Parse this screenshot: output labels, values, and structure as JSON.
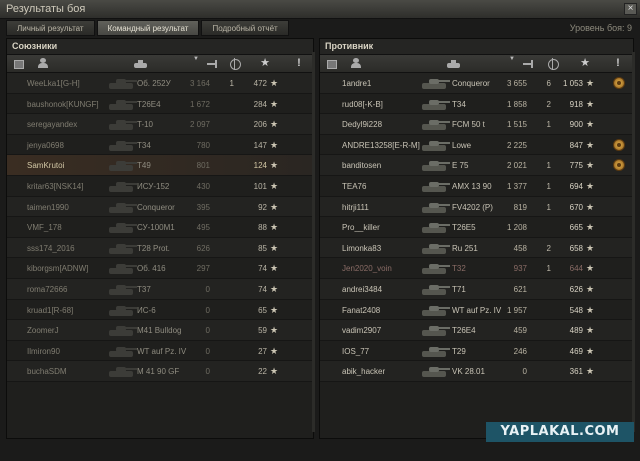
{
  "window": {
    "title": "Результаты боя",
    "close_label": "×"
  },
  "tabs": [
    {
      "label": "Личный результат",
      "active": false
    },
    {
      "label": "Командный результат",
      "active": true
    },
    {
      "label": "Подробный отчёт",
      "active": false
    }
  ],
  "battle_level": "Уровень боя: 9",
  "allies": {
    "title": "Союзники",
    "columns": [
      "square-icon",
      "person-icon",
      "tank-icon",
      "sort-arrow-icon",
      "damage-arrow-icon",
      "crosshair-icon",
      "star-icon",
      "exclamation-icon"
    ],
    "rows": [
      {
        "player": "WeeLka1[G-H]",
        "tank": "Об. 252У",
        "damage": "3 164",
        "kills": "1",
        "exp": "472"
      },
      {
        "player": "baushonok[KUNGF]",
        "tank": "T26E4",
        "damage": "1 672",
        "kills": "",
        "exp": "284"
      },
      {
        "player": "seregayandex",
        "tank": "T-10",
        "damage": "2 097",
        "kills": "",
        "exp": "206"
      },
      {
        "player": "jenya0698",
        "tank": "T34",
        "damage": "780",
        "kills": "",
        "exp": "147"
      },
      {
        "player": "SamKrutoi",
        "tank": "T49",
        "damage": "801",
        "kills": "",
        "exp": "124",
        "self": true
      },
      {
        "player": "kritar63[NSK14]",
        "tank": "ИСУ-152",
        "damage": "430",
        "kills": "",
        "exp": "101"
      },
      {
        "player": "taimen1990",
        "tank": "Conqueror",
        "damage": "395",
        "kills": "",
        "exp": "92"
      },
      {
        "player": "VMF_178",
        "tank": "СУ-100М1",
        "damage": "495",
        "kills": "",
        "exp": "88"
      },
      {
        "player": "sss174_2016",
        "tank": "T28 Prot.",
        "damage": "626",
        "kills": "",
        "exp": "85"
      },
      {
        "player": "kiborgsm[ADNW]",
        "tank": "Об. 416",
        "damage": "297",
        "kills": "",
        "exp": "74"
      },
      {
        "player": "roma72666",
        "tank": "T37",
        "damage": "0",
        "kills": "",
        "exp": "74"
      },
      {
        "player": "kruad1[R-68]",
        "tank": "ИС-6",
        "damage": "0",
        "kills": "",
        "exp": "65"
      },
      {
        "player": "ZoomerJ",
        "tank": "M41 Bulldog",
        "damage": "0",
        "kills": "",
        "exp": "59"
      },
      {
        "player": "Ilmiron90",
        "tank": "WT auf Pz. IV",
        "damage": "0",
        "kills": "",
        "exp": "27"
      },
      {
        "player": "buchaSDM",
        "tank": "M 41 90 GF",
        "damage": "0",
        "kills": "",
        "exp": "22"
      }
    ]
  },
  "enemies": {
    "title": "Противник",
    "columns": [
      "square-icon",
      "person-icon",
      "tank-icon",
      "sort-arrow-icon",
      "damage-arrow-icon",
      "crosshair-icon",
      "star-icon",
      "exclamation-icon"
    ],
    "rows": [
      {
        "player": "1andre1",
        "tank": "Conqueror",
        "damage": "3 655",
        "kills": "6",
        "exp": "1 053",
        "medal": true
      },
      {
        "player": "rud08[-K-B]",
        "tank": "T34",
        "damage": "1 858",
        "kills": "2",
        "exp": "918"
      },
      {
        "player": "Dedyl9i228",
        "tank": "FCM 50 t",
        "damage": "1 515",
        "kills": "1",
        "exp": "900"
      },
      {
        "player": "ANDRE13258[E-R-M]",
        "tank": "Lowe",
        "damage": "2 225",
        "kills": "",
        "exp": "847",
        "medal": true
      },
      {
        "player": "banditosen",
        "tank": "E 75",
        "damage": "2 021",
        "kills": "1",
        "exp": "775",
        "medal": true
      },
      {
        "player": "TEA76",
        "tank": "AMX 13 90",
        "damage": "1 377",
        "kills": "1",
        "exp": "694"
      },
      {
        "player": "hitrji111",
        "tank": "FV4202 (P)",
        "damage": "819",
        "kills": "1",
        "exp": "670"
      },
      {
        "player": "Pro__killer",
        "tank": "T26E5",
        "damage": "1 208",
        "kills": "",
        "exp": "665"
      },
      {
        "player": "Limonka83",
        "tank": "Ru 251",
        "damage": "458",
        "kills": "2",
        "exp": "658"
      },
      {
        "player": "Jen2020_voin",
        "tank": "T32",
        "damage": "937",
        "kills": "1",
        "exp": "644",
        "dead": true
      },
      {
        "player": "andrei3484",
        "tank": "T71",
        "damage": "621",
        "kills": "",
        "exp": "626"
      },
      {
        "player": "Fanat2408",
        "tank": "WT auf Pz. IV",
        "damage": "1 957",
        "kills": "",
        "exp": "548"
      },
      {
        "player": "vadim2907",
        "tank": "T26E4",
        "damage": "459",
        "kills": "",
        "exp": "489"
      },
      {
        "player": "IOS_77",
        "tank": "T29",
        "damage": "246",
        "kills": "",
        "exp": "469"
      },
      {
        "player": "abik_hacker",
        "tank": "VK 28.01",
        "damage": "0",
        "kills": "",
        "exp": "361"
      }
    ]
  },
  "watermark": "YAPLAKAL.COM"
}
